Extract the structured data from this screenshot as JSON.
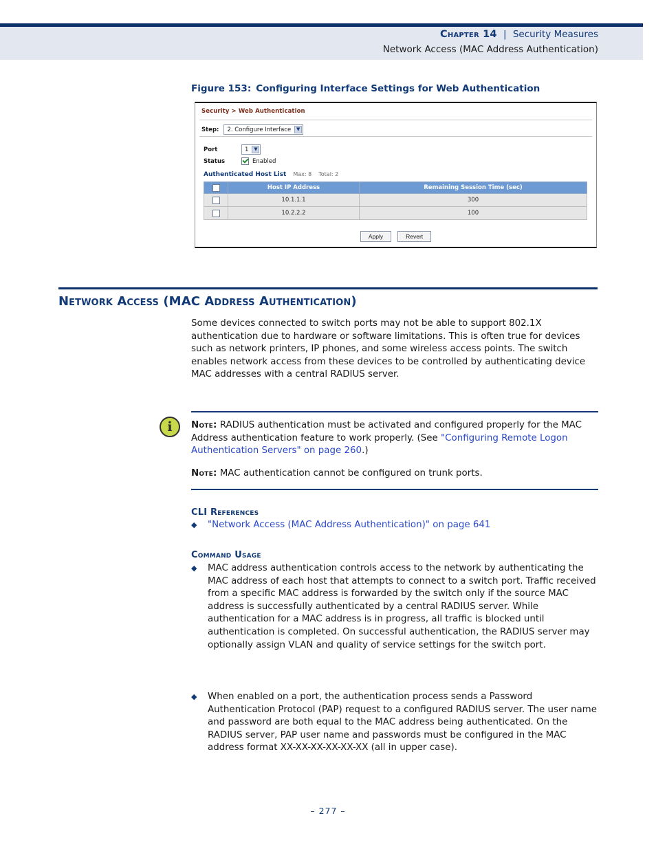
{
  "header": {
    "chapter": "Chapter 14",
    "separator": "|",
    "chapter_title": "Security Measures",
    "subtitle": "Network Access (MAC Address Authentication)",
    "accent_color": "#123a77",
    "band_color": "#e3e7f0"
  },
  "figure": {
    "number": "Figure 153:",
    "caption": "Configuring Interface Settings for Web Authentication",
    "ui": {
      "breadcrumb": "Security > Web Authentication",
      "step_label": "Step:",
      "step_value": "2. Configure Interface",
      "port_label": "Port",
      "port_value": "1",
      "status_label": "Status",
      "status_checkbox_label": "Enabled",
      "list_title": "Authenticated Host List",
      "list_max": "Max: 8",
      "list_total": "Total: 2",
      "table": {
        "headers": [
          "",
          "Host IP Address",
          "Remaining Session Time (sec)"
        ],
        "rows": [
          {
            "ip": "10.1.1.1",
            "time": "300"
          },
          {
            "ip": "10.2.2.2",
            "time": "100"
          }
        ]
      },
      "buttons": {
        "apply": "Apply",
        "revert": "Revert"
      },
      "header_row_color": "#6e9ad4",
      "row_color": "#e6e6e6"
    }
  },
  "section": {
    "heading": "Network Access (MAC Address Authentication)",
    "intro": "Some devices connected to switch ports may not be able to support 802.1X authentication due to hardware or software limitations. This is often true for devices such as network printers, IP phones, and some wireless access points. The switch enables network access from these devices to be controlled by authenticating device MAC addresses with a central RADIUS server."
  },
  "note": {
    "icon_glyph": "i",
    "icon_color": "#c7d94a",
    "label": "Note:",
    "note1_before": " RADIUS authentication must be activated and configured properly for the MAC Address authentication feature to work properly. (See ",
    "note1_link": "\"Configuring Remote Logon Authentication Servers\" on page 260",
    "note1_after": ".)",
    "note2_text": " MAC authentication cannot be configured on trunk ports."
  },
  "cli_references": {
    "heading": "CLI References",
    "bullet_mark": "◆",
    "items": [
      "\"Network Access (MAC Address Authentication)\" on page 641"
    ]
  },
  "command_usage": {
    "heading": "Command Usage",
    "bullet_mark": "◆",
    "items": [
      "MAC address authentication controls access to the network by authenticating the MAC address of each host that attempts to connect to a switch port. Traffic received from a specific MAC address is forwarded by the switch only if the source MAC address is successfully authenticated by a central RADIUS server. While authentication for a MAC address is in progress, all traffic is blocked until authentication is completed. On successful authentication, the RADIUS server may optionally assign VLAN and quality of service settings for the switch port.",
      "When enabled on a port, the authentication process sends a Password Authentication Protocol (PAP) request to a configured RADIUS server. The user name and password are both equal to the MAC address being authenticated. On the RADIUS server, PAP user name and passwords must be configured in the MAC address format XX-XX-XX-XX-XX-XX (all in upper case)."
    ]
  },
  "footer": {
    "page_number": "–  277  –"
  }
}
